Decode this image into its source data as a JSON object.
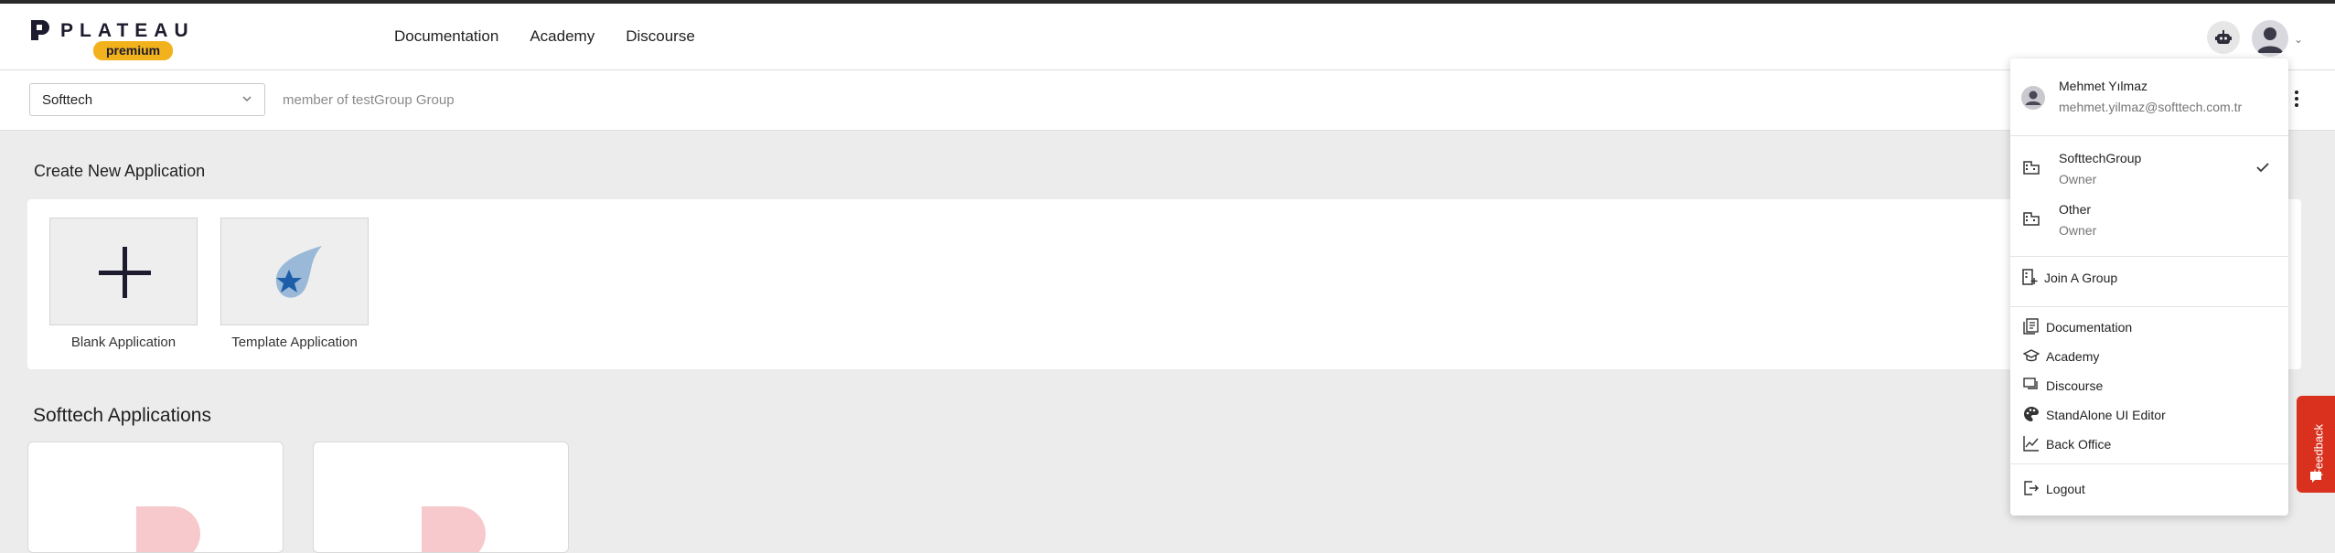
{
  "brand": {
    "name": "PLATEAU",
    "badge": "premium"
  },
  "topnav": {
    "items": [
      "Documentation",
      "Academy",
      "Discourse"
    ]
  },
  "group_selector": {
    "value": "Softtech",
    "membership": "member of testGroup Group"
  },
  "create_section": {
    "title": "Create New Application",
    "tiles": [
      "Blank Application",
      "Template Application"
    ]
  },
  "apps_section": {
    "title": "Softtech Applications"
  },
  "user_menu": {
    "user": {
      "name": "Mehmet Yılmaz",
      "email": "mehmet.yilmaz@softtech.com.tr"
    },
    "groups": [
      {
        "name": "SofttechGroup",
        "role": "Owner",
        "selected": true
      },
      {
        "name": "Other",
        "role": "Owner",
        "selected": false
      }
    ],
    "join_label": "Join A Group",
    "links": [
      "Documentation",
      "Academy",
      "Discourse",
      "StandAlone UI Editor",
      "Back Office"
    ],
    "logout_label": "Logout"
  },
  "feedback": {
    "label": "Feedback"
  },
  "colors": {
    "brand_badge": "#f2b21c",
    "feedback": "#d9311e",
    "template_icon": "#1d5ea8"
  }
}
